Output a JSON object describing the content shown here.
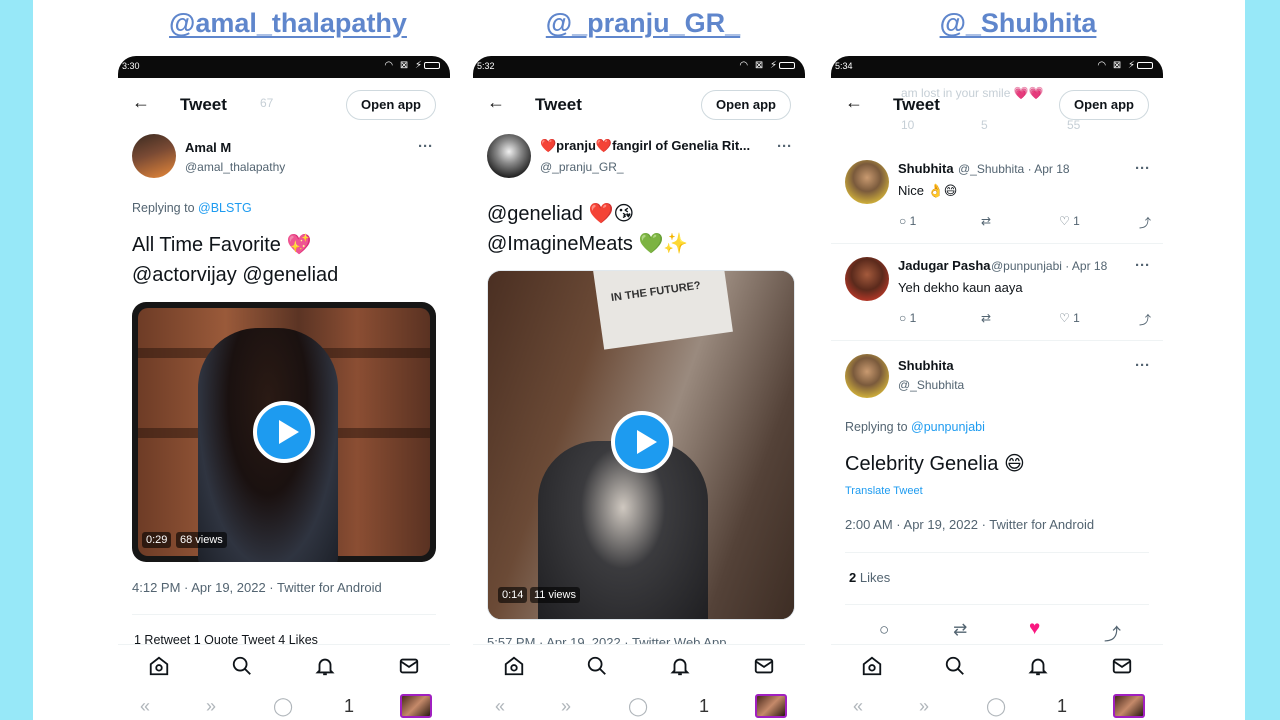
{
  "handles": [
    "@amal_thalapathy",
    "@_pranju_GR_",
    "@_Shubhita"
  ],
  "common": {
    "tweet_title": "Tweet",
    "open_app": "Open app",
    "back_glyph": "←",
    "more_glyph": "···"
  },
  "phone1": {
    "time": "3:30",
    "ghost_retweets": "67",
    "name": "Amal M",
    "username": "@amal_thalapathy",
    "replying_prefix": "Replying to ",
    "replying_to": "@BLSTG",
    "text_line1": "All Time Favorite 💖",
    "text_line2": "@actorvijay @geneliad",
    "video_duration": "0:29",
    "video_views": "68 views",
    "timestamp": "4:12 PM · Apr 19, 2022 · Twitter for Android",
    "stats": "1 Retweet   1 Quote Tweet   4 Likes"
  },
  "phone2": {
    "time": "5:32",
    "name": "❤️pranju❤️fangirl of Genelia Rit...",
    "username": "@_pranju_GR_",
    "text_line1": "@geneliad ❤️😘",
    "text_line2": "@ImagineMeats 💚✨",
    "video_sign": "IN THE FUTURE?",
    "video_duration": "0:14",
    "video_views": "11 views",
    "timestamp": "5:57 PM · Apr 19, 2022 · Twitter Web App"
  },
  "phone3": {
    "time": "5:34",
    "ghost_text": "am lost in your smile 💗💗",
    "ghost_stats": [
      "10",
      "5",
      "55"
    ],
    "reply1": {
      "name": "Shubhita",
      "meta": "@_Shubhita · Apr 18",
      "text": "Nice 👌😄",
      "replies": "1",
      "likes": "1"
    },
    "reply2": {
      "name": "Jadugar Pasha",
      "meta": "@punpunjabi · Apr 18",
      "text": "Yeh dekho kaun aaya",
      "replies": "1",
      "likes": "1"
    },
    "main": {
      "name": "Shubhita",
      "username": "@_Shubhita",
      "replying_prefix": "Replying to ",
      "replying_to": "@punpunjabi",
      "text": "Celebrity Genelia 😄",
      "translate": "Translate Tweet",
      "timestamp": "2:00 AM · Apr 19, 2022 · Twitter for Android",
      "likes_count": "2",
      "likes_label": " Likes"
    }
  },
  "sysnav_page": "1",
  "icons": {
    "home": "home-icon",
    "search": "search-icon",
    "notifications": "bell-icon",
    "messages": "mail-icon"
  },
  "colors": {
    "background": "#97e8f8",
    "handle": "#5f86cc",
    "link": "#1d9bf0",
    "like_active": "#f91880"
  }
}
